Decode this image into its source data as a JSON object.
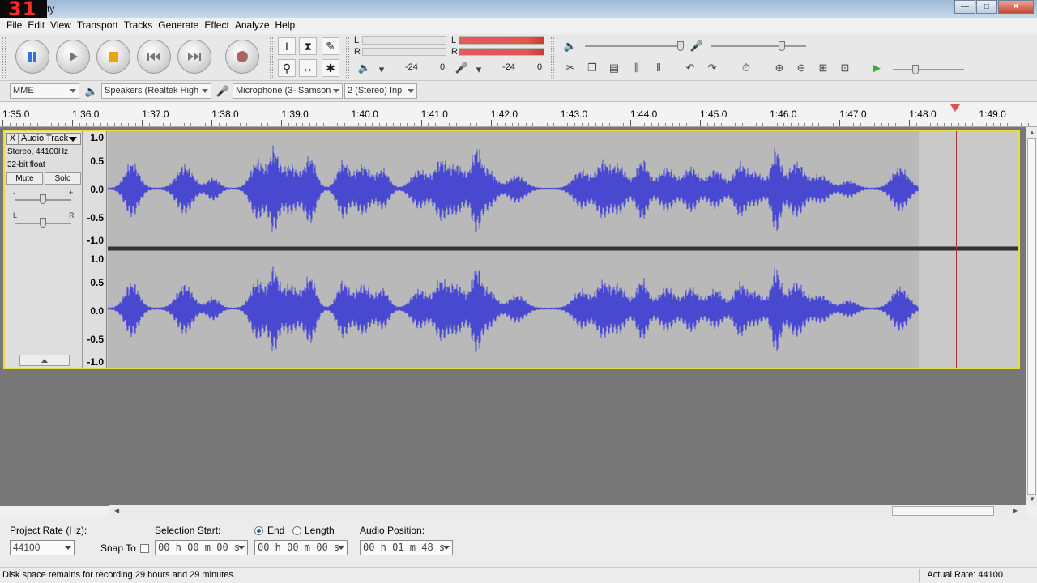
{
  "window": {
    "title_badge": "31",
    "title": "ty",
    "min_btn": "—",
    "max_btn": "□",
    "close_btn": "✕"
  },
  "menu": [
    "File",
    "Edit",
    "View",
    "Transport",
    "Tracks",
    "Generate",
    "Effect",
    "Analyze",
    "Help"
  ],
  "meters": {
    "playback_left": "L",
    "playback_right": "R",
    "record_left": "L",
    "record_right": "R",
    "playback_scale": [
      "-24",
      "0"
    ],
    "record_scale": [
      "-24",
      "0"
    ]
  },
  "devices": {
    "host": "MME",
    "output": "Speakers (Realtek High",
    "input": "Microphone (3- Samson",
    "channels": "2 (Stereo) Inp"
  },
  "ruler": {
    "labels": [
      "1:35.0",
      "1:36.0",
      "1:37.0",
      "1:38.0",
      "1:39.0",
      "1:40.0",
      "1:41.0",
      "1:42.0",
      "1:43.0",
      "1:44.0",
      "1:45.0",
      "1:46.0",
      "1:47.0",
      "1:48.0",
      "1:49.0"
    ]
  },
  "track": {
    "close": "X",
    "name": "Audio Track",
    "format": "Stereo, 44100Hz",
    "bitdepth": "32-bit float",
    "mute": "Mute",
    "solo": "Solo",
    "gain_minus": "-",
    "gain_plus": "+",
    "pan_left": "L",
    "pan_right": "R",
    "vscale": [
      "1.0",
      "0.5",
      "0.0",
      "-0.5",
      "-1.0"
    ],
    "wave_color": "#4848d0"
  },
  "selection": {
    "project_rate_label": "Project Rate (Hz):",
    "project_rate": "44100",
    "snap_label": "Snap To",
    "sel_start_label": "Selection Start:",
    "end_label": "End",
    "length_label": "Length",
    "audio_pos_label": "Audio Position:",
    "sel_start": "00 h 00 m 00 s",
    "sel_end": "00 h 00 m 00 s",
    "audio_pos": "00 h 01 m 48 s"
  },
  "status": {
    "text": "Disk space remains for recording 29 hours and 29 minutes.",
    "rate": "Actual Rate: 44100"
  }
}
